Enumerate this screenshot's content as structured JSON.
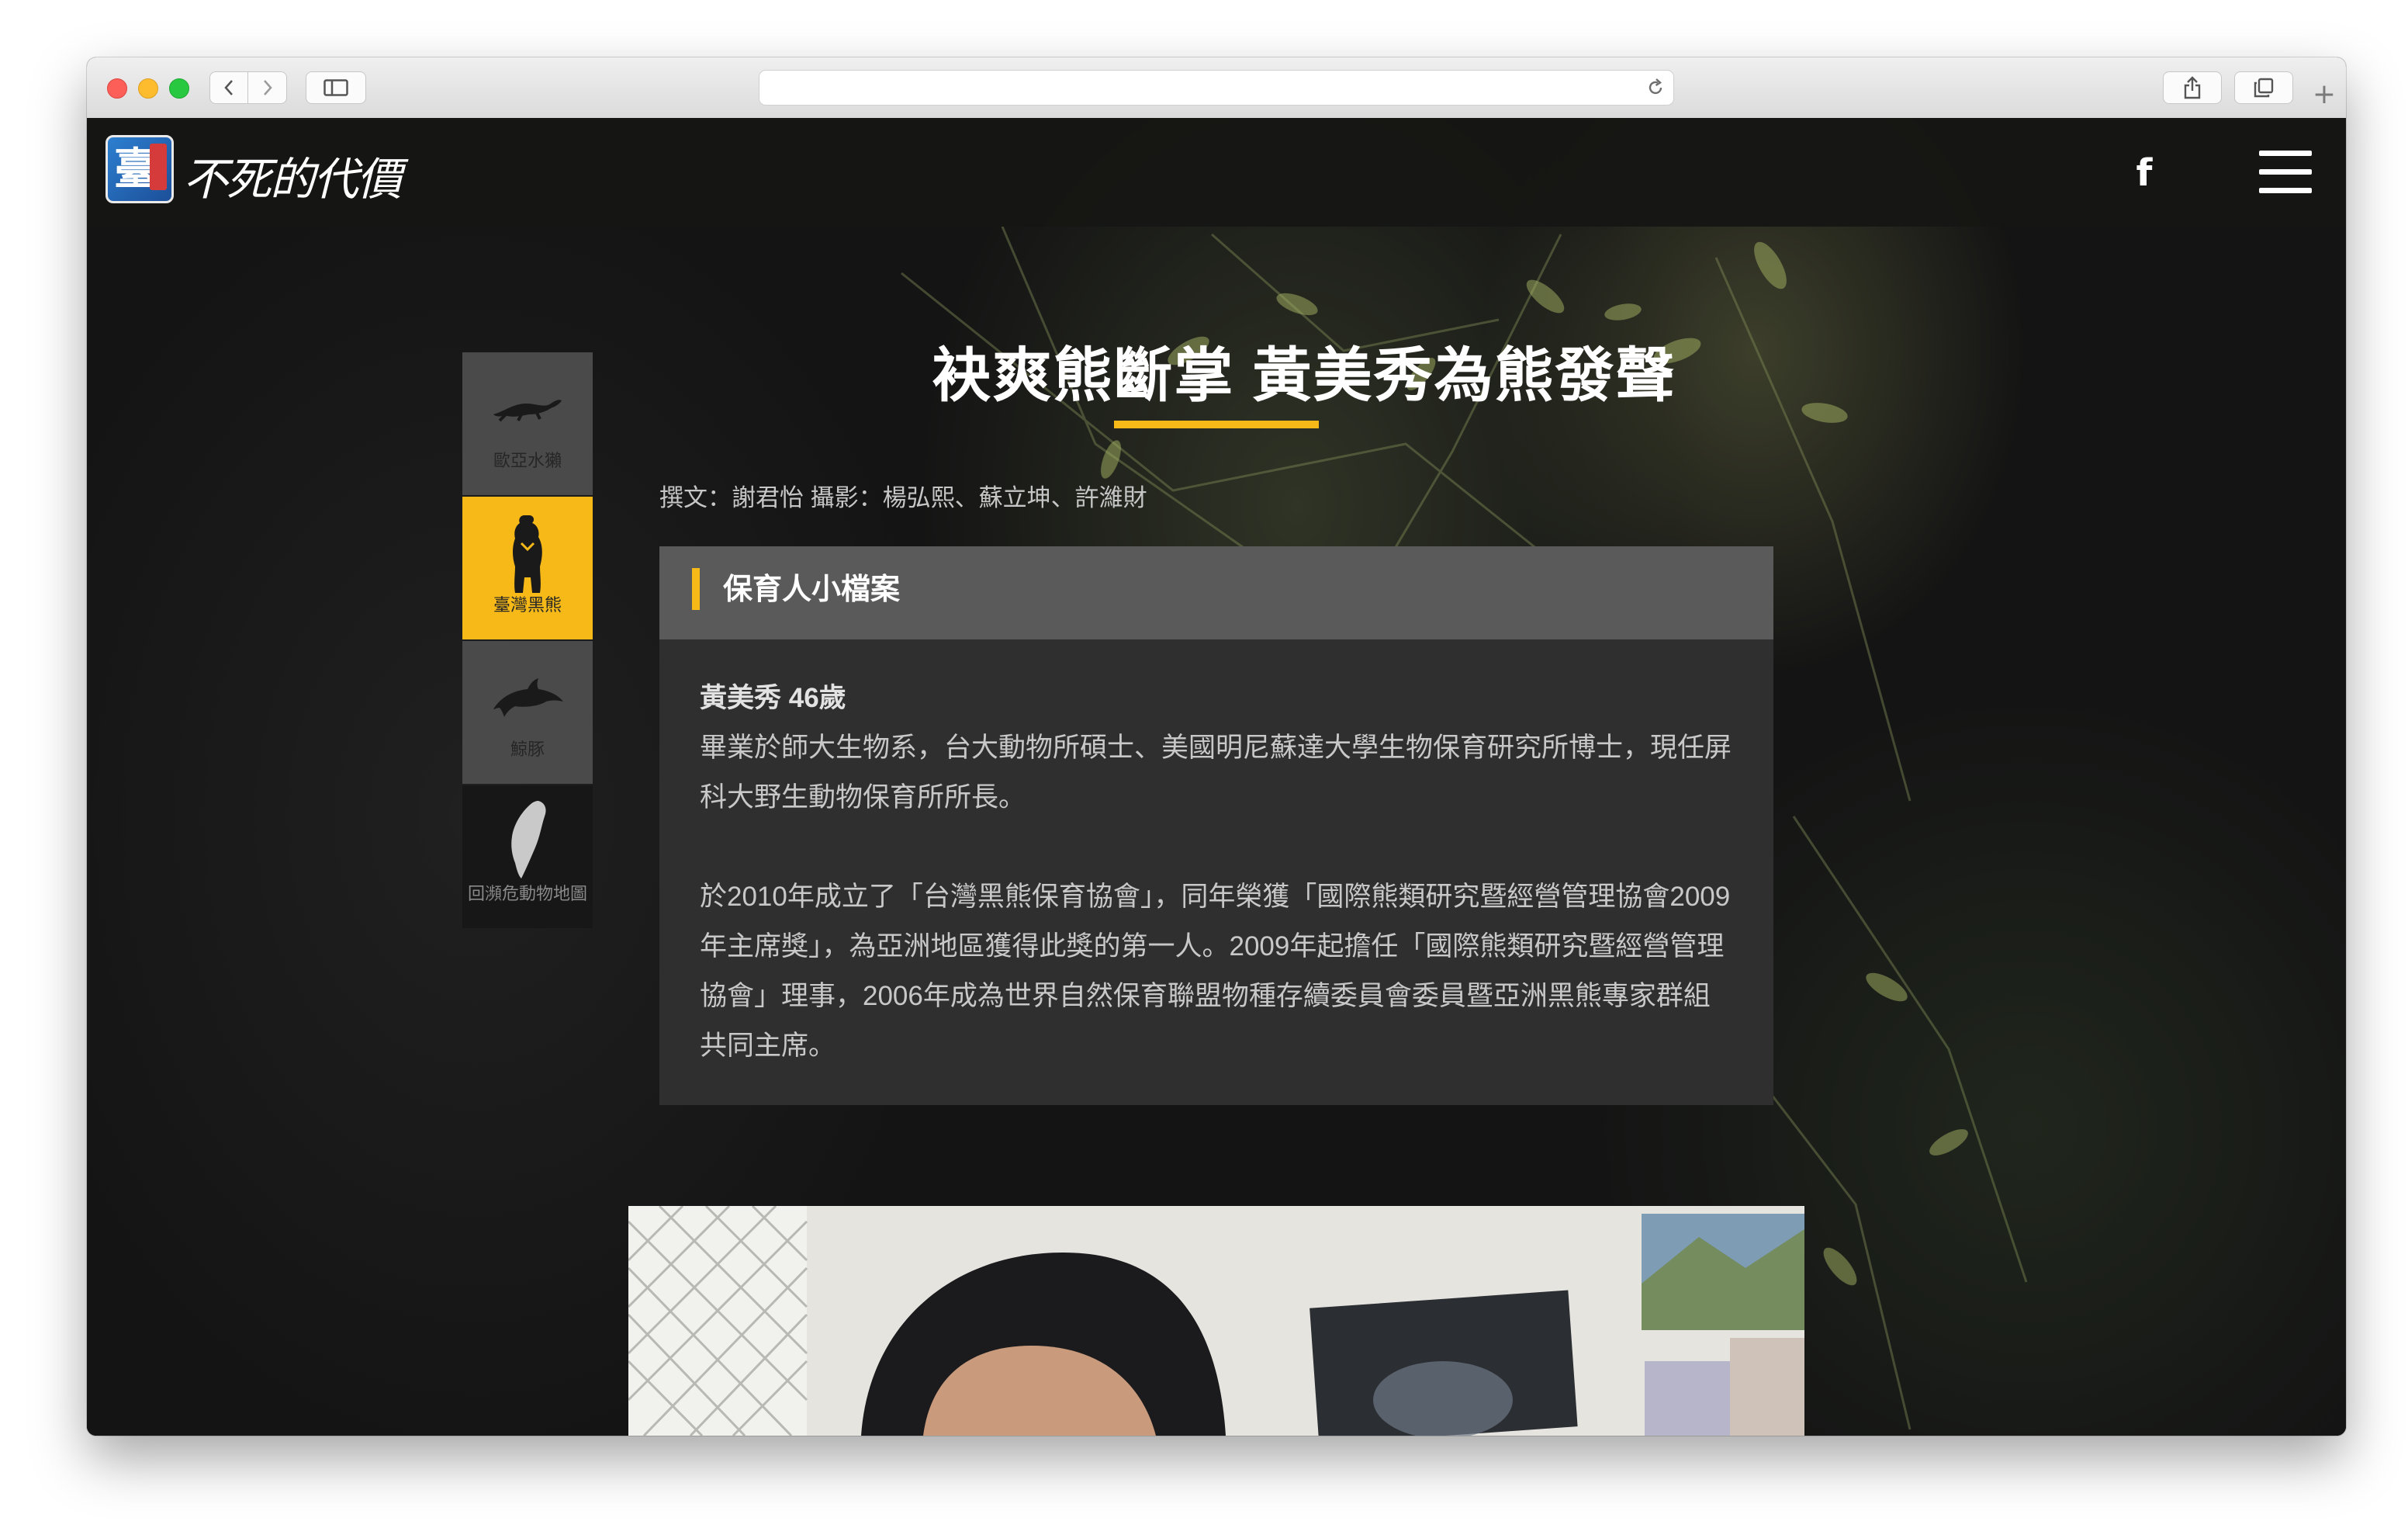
{
  "site": {
    "logo_badge": "臺",
    "logo_text": "不死的代價",
    "facebook_glyph": "f"
  },
  "species_nav": [
    {
      "label": "歐亞水獺",
      "icon": "otter-icon",
      "state": "default"
    },
    {
      "label": "臺灣黑熊",
      "icon": "bear-icon",
      "state": "active"
    },
    {
      "label": "鯨豚",
      "icon": "dolphin-icon",
      "state": "default"
    },
    {
      "label": "回瀕危動物地圖",
      "icon": "taiwan-map-icon",
      "state": "dark"
    }
  ],
  "article": {
    "title": "袂爽熊斷掌 黃美秀為熊發聲",
    "byline": "撰文：謝君怡 攝影：楊弘熙、蘇立坤、許濰財"
  },
  "profile": {
    "heading": "保育人小檔案",
    "name": "黃美秀 46歲",
    "paragraph1": "畢業於師大生物系，台大動物所碩士、美國明尼蘇達大學生物保育研究所博士，現任屏科大野生動物保育所所長。",
    "paragraph2": "於2010年成立了「台灣黑熊保育協會」，同年榮獲「國際熊類研究暨經營管理協會2009年主席獎」，為亞洲地區獲得此獎的第一人。2009年起擔任「國際熊類研究暨經營管理協會」理事，2006年成為世界自然保育聯盟物種存續委員會委員暨亞洲黑熊專家群組共同主席。"
  },
  "colors": {
    "accent": "#f6b918",
    "card_header": "#5a5a5a",
    "card_body": "#2f2f2f",
    "nav_default": "#4a4a4a"
  }
}
